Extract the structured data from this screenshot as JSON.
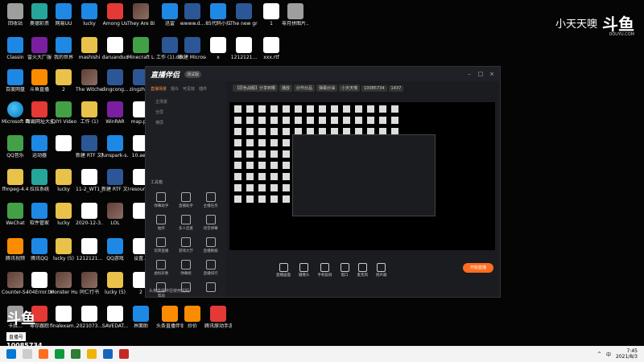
{
  "watermark": {
    "streamer": "小天天噢",
    "logo": "斗鱼",
    "sub": "DOUYU.COM"
  },
  "corner_logo": {
    "big": "斗鱼",
    "tag": "直播号",
    "id": "10085734"
  },
  "desktop_icons": [
    {
      "label": "回收站",
      "kind": "gray"
    },
    {
      "label": "奥德彩票",
      "kind": "teal"
    },
    {
      "label": "网易UU",
      "kind": "blue"
    },
    {
      "label": "lucky",
      "kind": "blue"
    },
    {
      "label": "Among Us",
      "kind": "red"
    },
    {
      "label": "They Are Billions",
      "kind": "game"
    },
    {
      "label": "迅雷",
      "kind": "blue"
    },
    {
      "label": "wwww.d...",
      "kind": "word"
    },
    {
      "label": "85代码小拉",
      "kind": "blue"
    },
    {
      "label": "The new green rev...",
      "kind": "word"
    },
    {
      "label": "1",
      "kind": "doc"
    },
    {
      "label": "零月拼图片...mp4",
      "kind": "gray"
    },
    {
      "label": "Classin",
      "kind": "blue"
    },
    {
      "label": "雷火大厂服",
      "kind": "purple"
    },
    {
      "label": "我的世界",
      "kind": "blue"
    },
    {
      "label": "mashishi",
      "kind": "folder"
    },
    {
      "label": "daruanduo",
      "kind": "doc"
    },
    {
      "label": "Minecraft Launcher",
      "kind": "green"
    },
    {
      "label": "工作 (1).docx",
      "kind": "word"
    },
    {
      "label": "新建 Microsoft...",
      "kind": "word"
    },
    {
      "label": "x",
      "kind": "doc"
    },
    {
      "label": "1212121...",
      "kind": "doc"
    },
    {
      "label": "xxx.rtf",
      "kind": "doc"
    },
    {
      "label": "百度网盘",
      "kind": "blue"
    },
    {
      "label": "斗鱼直播",
      "kind": "orange"
    },
    {
      "label": "2",
      "kind": "folder"
    },
    {
      "label": "The Witcher",
      "kind": "game"
    },
    {
      "label": "dingcong...",
      "kind": "word"
    },
    {
      "label": "zingzhe...",
      "kind": "word"
    },
    {
      "label": "Microsoft Edge",
      "kind": "edge"
    },
    {
      "label": "毒霸网址大全",
      "kind": "red"
    },
    {
      "label": "iQIYI Video",
      "kind": "green"
    },
    {
      "label": "工作 (1)",
      "kind": "folder"
    },
    {
      "label": "WinRAR",
      "kind": "purple"
    },
    {
      "label": "map.p...",
      "kind": "doc"
    },
    {
      "label": "QQ音乐",
      "kind": "green"
    },
    {
      "label": "运动器",
      "kind": "blue"
    },
    {
      "label": "",
      "kind": "doc"
    },
    {
      "label": "新建 RTF 文档",
      "kind": "word"
    },
    {
      "label": "funspark-s...",
      "kind": "blue"
    },
    {
      "label": "10.ae...",
      "kind": "doc"
    },
    {
      "label": "ffmpeg-4.4",
      "kind": "folder"
    },
    {
      "label": "拉拉系统",
      "kind": "teal"
    },
    {
      "label": "lucky",
      "kind": "folder"
    },
    {
      "label": "11-2_WT1_...",
      "kind": "doc"
    },
    {
      "label": "新建 RTF 文档.rtf",
      "kind": "word"
    },
    {
      "label": "resourc...",
      "kind": "doc"
    },
    {
      "label": "WeChat",
      "kind": "green"
    },
    {
      "label": "软件管家",
      "kind": "blue"
    },
    {
      "label": "lucky",
      "kind": "folder"
    },
    {
      "label": "2020-12-3...",
      "kind": "doc"
    },
    {
      "label": "LOL",
      "kind": "game"
    },
    {
      "label": "",
      "kind": "doc"
    },
    {
      "label": "腾讯视频",
      "kind": "orange"
    },
    {
      "label": "腾讯QQ",
      "kind": "blue"
    },
    {
      "label": "lucky (5)",
      "kind": "folder"
    },
    {
      "label": "1212121...",
      "kind": "doc"
    },
    {
      "label": "QQ游戏",
      "kind": "blue"
    },
    {
      "label": "设置...",
      "kind": "doc"
    },
    {
      "label": "Counter-S... Global Off...",
      "kind": "game"
    },
    {
      "label": "404Error.txt",
      "kind": "doc"
    },
    {
      "label": "Monster Hunter...",
      "kind": "game"
    },
    {
      "label": "同仁行书",
      "kind": "game"
    },
    {
      "label": "lucky (5)",
      "kind": "folder"
    },
    {
      "label": "2",
      "kind": "doc"
    },
    {
      "label": "卡拉...",
      "kind": "gray"
    },
    {
      "label": "零存跟踪",
      "kind": "red"
    },
    {
      "label": "finalexam...",
      "kind": "doc"
    },
    {
      "label": "2021073...",
      "kind": "doc"
    },
    {
      "label": "SAVEDAT...",
      "kind": "doc"
    },
    {
      "label": "界面助",
      "kind": "blue"
    },
    {
      "label": "头条直播伴侣",
      "kind": "orange"
    },
    {
      "label": "炒价",
      "kind": "orange"
    },
    {
      "label": "腾讯原动手游",
      "kind": "red"
    }
  ],
  "app": {
    "brand": "直播伴侣",
    "version": "测试版",
    "tabs": [
      "直播场景",
      "观众",
      "可见效",
      "插件"
    ],
    "scenes": [
      "主场景",
      "全屏",
      "横屏"
    ],
    "tool_header": "工具箱",
    "tools": [
      "弹幕助手",
      "直播助手",
      "主播任务",
      "抽奖",
      "多人连麦",
      "语音弹幕",
      "玩转直播",
      "游戏大厅",
      "直播数据",
      "虚拟形象",
      "弹幕姬",
      "直播排行",
      "帮助",
      "",
      ""
    ],
    "top_info": [
      "【原色战服】分享到哪",
      "播放",
      "炒作炒品",
      "弹幕炒油",
      "小天天噢",
      "10085734",
      "1437"
    ],
    "controls": [
      "直播画面",
      "摄像头",
      "手机投屏",
      "窗口",
      "麦克风",
      "扬声器"
    ],
    "start_live": "开始直播",
    "bottom_tip": "头条直播伴侣使用说明"
  },
  "taskbar": {
    "time": "7:45",
    "date": "2021/8/3",
    "lang": "中"
  }
}
